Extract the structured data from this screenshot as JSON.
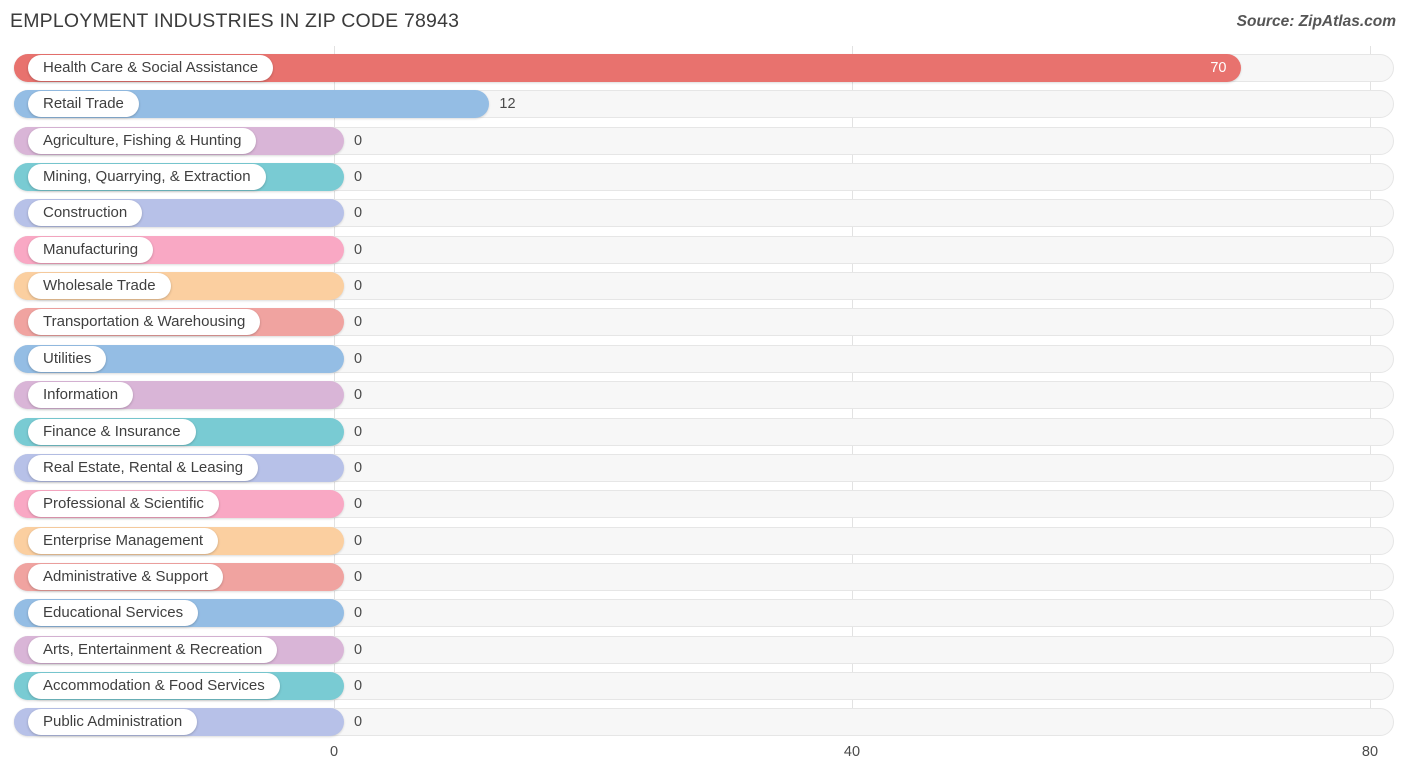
{
  "header": {
    "title": "EMPLOYMENT INDUSTRIES IN ZIP CODE 78943",
    "source": "Source: ZipAtlas.com"
  },
  "chart_data": {
    "type": "bar",
    "orientation": "horizontal",
    "title": "EMPLOYMENT INDUSTRIES IN ZIP CODE 78943",
    "xlabel": "",
    "ylabel": "",
    "xlim": [
      0,
      80
    ],
    "xticks": [
      0,
      40,
      80
    ],
    "xtick_labels": [
      "0",
      "40",
      "80"
    ],
    "grid": true,
    "legend": "none",
    "categories": [
      "Health Care & Social Assistance",
      "Retail Trade",
      "Agriculture, Fishing & Hunting",
      "Mining, Quarrying, & Extraction",
      "Construction",
      "Manufacturing",
      "Wholesale Trade",
      "Transportation & Warehousing",
      "Utilities",
      "Information",
      "Finance & Insurance",
      "Real Estate, Rental & Leasing",
      "Professional & Scientific",
      "Enterprise Management",
      "Administrative & Support",
      "Educational Services",
      "Arts, Entertainment & Recreation",
      "Accommodation & Food Services",
      "Public Administration"
    ],
    "values": [
      70,
      12,
      0,
      0,
      0,
      0,
      0,
      0,
      0,
      0,
      0,
      0,
      0,
      0,
      0,
      0,
      0,
      0,
      0
    ],
    "value_labels": [
      "70",
      "12",
      "0",
      "0",
      "0",
      "0",
      "0",
      "0",
      "0",
      "0",
      "0",
      "0",
      "0",
      "0",
      "0",
      "0",
      "0",
      "0",
      "0"
    ],
    "colors": [
      "#e8726e",
      "#94bde4",
      "#d9b5d7",
      "#79cbd3",
      "#b7c1e8",
      "#f9a8c4",
      "#fbcfa0",
      "#f0a3a0",
      "#94bde4",
      "#d9b5d7",
      "#79cbd3",
      "#b7c1e8",
      "#f9a8c4",
      "#fbcfa0",
      "#f0a3a0",
      "#94bde4",
      "#d9b5d7",
      "#79cbd3",
      "#b7c1e8"
    ]
  }
}
